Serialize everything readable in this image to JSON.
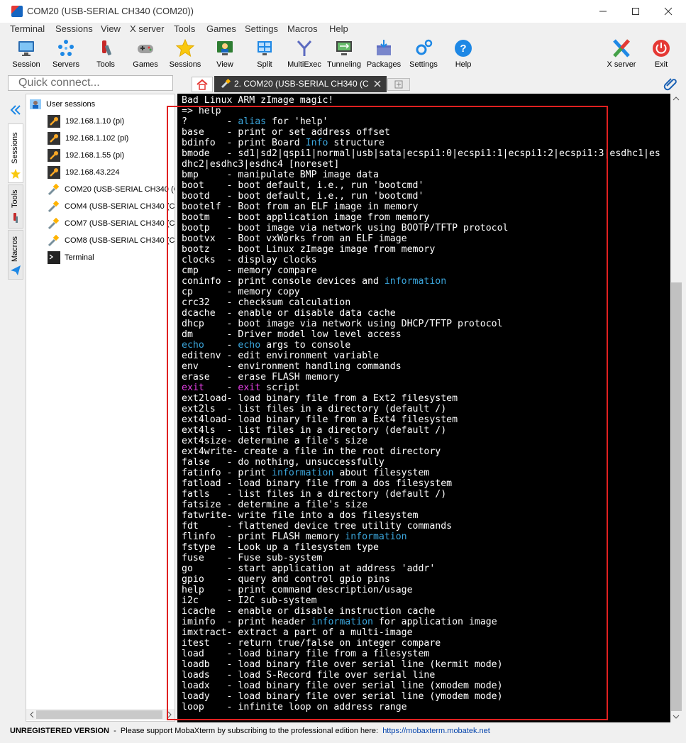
{
  "window": {
    "title": "COM20  (USB-SERIAL CH340 (COM20))",
    "minimize_icon": "minimize",
    "maximize_icon": "maximize",
    "close_icon": "close"
  },
  "menu": [
    "Terminal",
    "Sessions",
    "View",
    "X server",
    "Tools",
    "Games",
    "Settings",
    "Macros",
    "Help"
  ],
  "toolbar": {
    "buttons": [
      "Session",
      "Servers",
      "Tools",
      "Games",
      "Sessions",
      "View",
      "Split",
      "MultiExec",
      "Tunneling",
      "Packages",
      "Settings",
      "Help"
    ],
    "xserver": "X server",
    "exit": "Exit"
  },
  "quick_connect": {
    "placeholder": "Quick connect..."
  },
  "tabs": {
    "active": "2. COM20  (USB-SERIAL CH340 (C"
  },
  "sidebar": {
    "tabs": [
      "Sessions",
      "Tools",
      "Macros"
    ],
    "root": "User sessions",
    "sessions": [
      "192.168.1.10 (pi)",
      "192.168.1.102 (pi)",
      "192.168.1.55 (pi)",
      "192.168.43.224",
      "COM20  (USB-SERIAL CH340 (C",
      "COM4  (USB-SERIAL CH340 (CO",
      "COM7  (USB-SERIAL CH340 (CO",
      "COM8  (USB-SERIAL CH340 (CO",
      "Terminal"
    ]
  },
  "terminal": {
    "header": "Bad Linux ARM zImage magic!",
    "prompt": "=> help",
    "commands": [
      [
        "?",
        "alias for 'help'"
      ],
      [
        "base",
        "print or set address offset"
      ],
      [
        "bdinfo",
        "print Board Info structure"
      ],
      [
        "bmode",
        "sd1|sd2|qspi1|normal|usb|sata|ecspi1:0|ecspi1:1|ecspi1:2|ecspi1:3|esdhc1|esdhc2|esdhc3|esdhc4 [noreset]"
      ],
      [
        "bmp",
        "manipulate BMP image data"
      ],
      [
        "boot",
        "boot default, i.e., run 'bootcmd'"
      ],
      [
        "bootd",
        "boot default, i.e., run 'bootcmd'"
      ],
      [
        "bootelf",
        "Boot from an ELF image in memory"
      ],
      [
        "bootm",
        "boot application image from memory"
      ],
      [
        "bootp",
        "boot image via network using BOOTP/TFTP protocol"
      ],
      [
        "bootvx",
        "Boot vxWorks from an ELF image"
      ],
      [
        "bootz",
        "boot Linux zImage image from memory"
      ],
      [
        "clocks",
        "display clocks"
      ],
      [
        "cmp",
        "memory compare"
      ],
      [
        "coninfo",
        "print console devices and information"
      ],
      [
        "cp",
        "memory copy"
      ],
      [
        "crc32",
        "checksum calculation"
      ],
      [
        "dcache",
        "enable or disable data cache"
      ],
      [
        "dhcp",
        "boot image via network using DHCP/TFTP protocol"
      ],
      [
        "dm",
        "Driver model low level access"
      ],
      [
        "echo",
        "echo args to console"
      ],
      [
        "editenv",
        "edit environment variable"
      ],
      [
        "env",
        "environment handling commands"
      ],
      [
        "erase",
        "erase FLASH memory"
      ],
      [
        "exit",
        "exit script"
      ],
      [
        "ext2load",
        "load binary file from a Ext2 filesystem"
      ],
      [
        "ext2ls",
        "list files in a directory (default /)"
      ],
      [
        "ext4load",
        "load binary file from a Ext4 filesystem"
      ],
      [
        "ext4ls",
        "list files in a directory (default /)"
      ],
      [
        "ext4size",
        "determine a file's size"
      ],
      [
        "ext4write",
        "create a file in the root directory"
      ],
      [
        "false",
        "do nothing, unsuccessfully"
      ],
      [
        "fatinfo",
        "print information about filesystem"
      ],
      [
        "fatload",
        "load binary file from a dos filesystem"
      ],
      [
        "fatls",
        "list files in a directory (default /)"
      ],
      [
        "fatsize",
        "determine a file's size"
      ],
      [
        "fatwrite",
        "write file into a dos filesystem"
      ],
      [
        "fdt",
        "flattened device tree utility commands"
      ],
      [
        "flinfo",
        "print FLASH memory information"
      ],
      [
        "fstype",
        "Look up a filesystem type"
      ],
      [
        "fuse",
        "Fuse sub-system"
      ],
      [
        "go",
        "start application at address 'addr'"
      ],
      [
        "gpio",
        "query and control gpio pins"
      ],
      [
        "help",
        "print command description/usage"
      ],
      [
        "i2c",
        "I2C sub-system"
      ],
      [
        "icache",
        "enable or disable instruction cache"
      ],
      [
        "iminfo",
        "print header information for application image"
      ],
      [
        "imxtract",
        "extract a part of a multi-image"
      ],
      [
        "itest",
        "return true/false on integer compare"
      ],
      [
        "load",
        "load binary file from a filesystem"
      ],
      [
        "loadb",
        "load binary file over serial line (kermit mode)"
      ],
      [
        "loads",
        "load S-Record file over serial line"
      ],
      [
        "loadx",
        "load binary file over serial line (xmodem mode)"
      ],
      [
        "loady",
        "load binary file over serial line (ymodem mode)"
      ],
      [
        "loop",
        "infinite loop on address range"
      ]
    ],
    "highlight_words": [
      "alias",
      "Info",
      "information",
      "echo"
    ],
    "magenta_words": [
      "exit"
    ]
  },
  "status": {
    "unregistered": "UNREGISTERED VERSION",
    "message": "  -  Please support MobaXterm by subscribing to the professional edition here:  ",
    "link": "https://mobaxterm.mobatek.net"
  },
  "colors": {
    "terminal_bg": "#000000",
    "terminal_fg": "#ffffff",
    "highlight": "#3ba6dc",
    "magenta": "#e43fe4",
    "annotation_box": "#e02020"
  }
}
